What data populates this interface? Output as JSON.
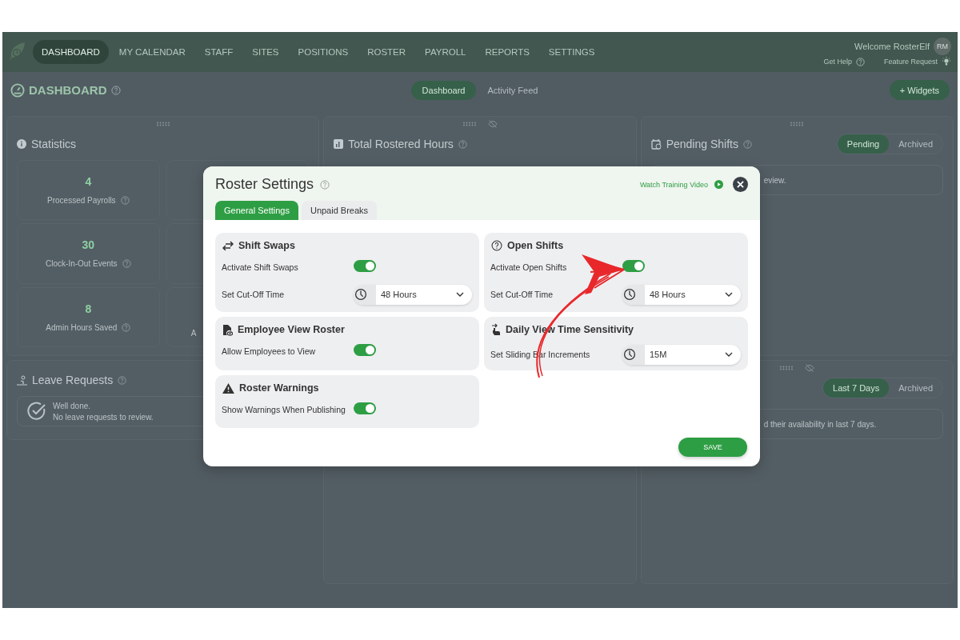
{
  "nav": {
    "items": [
      {
        "label": "DASHBOARD",
        "selected": true
      },
      {
        "label": "MY CALENDAR",
        "selected": false
      },
      {
        "label": "STAFF",
        "selected": false
      },
      {
        "label": "SITES",
        "selected": false
      },
      {
        "label": "POSITIONS",
        "selected": false
      },
      {
        "label": "ROSTER",
        "selected": false
      },
      {
        "label": "PAYROLL",
        "selected": false
      },
      {
        "label": "REPORTS",
        "selected": false
      },
      {
        "label": "SETTINGS",
        "selected": false
      }
    ],
    "welcome": "Welcome RosterElf",
    "avatar": "RM",
    "help": "Get Help",
    "feature": "Feature Request"
  },
  "header": {
    "title": "DASHBOARD",
    "views": [
      {
        "label": "Dashboard",
        "selected": true
      },
      {
        "label": "Activity Feed",
        "selected": false
      }
    ],
    "add_button": "+ Widgets"
  },
  "statistics": {
    "title": "Statistics",
    "stats": [
      {
        "value": "4",
        "label": "Processed Payrolls"
      },
      {
        "value": "30",
        "label": "Clock-In-Out Events"
      },
      {
        "value": "8",
        "label": "Admin Hours Saved"
      }
    ],
    "partial_label": "A"
  },
  "rostered_hours": {
    "title": "Total Rostered Hours"
  },
  "pending_shifts": {
    "title": "Pending Shifts",
    "filters": [
      {
        "label": "Pending",
        "selected": true
      },
      {
        "label": "Archived",
        "selected": false
      }
    ],
    "message": "eview."
  },
  "leave_requests": {
    "title": "Leave Requests",
    "message_title": "Well done.",
    "message": "No leave requests to review."
  },
  "availability": {
    "filters": [
      {
        "label": "Last 7 Days",
        "selected": true
      },
      {
        "label": "Archived",
        "selected": false
      }
    ],
    "message": "d their availability in last 7 days."
  },
  "modal": {
    "title": "Roster Settings",
    "video_link": "Watch Training Video",
    "tabs": [
      {
        "label": "General Settings",
        "selected": true
      },
      {
        "label": "Unpaid Breaks",
        "selected": false
      }
    ],
    "sections": [
      {
        "title": "Shift Swaps",
        "kind": "swap",
        "rows": [
          {
            "kind": "toggle",
            "label": "Activate Shift Swaps",
            "on": true
          },
          {
            "kind": "select",
            "label": "Set Cut-Off Time",
            "value": "48 Hours"
          }
        ]
      },
      {
        "title": "Open Shifts",
        "kind": "question",
        "rows": [
          {
            "kind": "toggle",
            "label": "Activate Open Shifts",
            "on": true
          },
          {
            "kind": "select",
            "label": "Set Cut-Off Time",
            "value": "48 Hours"
          }
        ]
      },
      {
        "title": "Employee View Roster",
        "kind": "document",
        "rows": [
          {
            "kind": "toggle",
            "label": "Allow Employees to View",
            "on": true
          }
        ]
      },
      {
        "title": "Daily View Time Sensitivity",
        "kind": "hand",
        "rows": [
          {
            "kind": "select",
            "label": "Set Sliding Bar Increments",
            "value": "15M"
          }
        ]
      },
      {
        "title": "Roster Warnings",
        "kind": "warning",
        "rows": [
          {
            "kind": "toggle",
            "label": "Show Warnings When Publishing",
            "on": true
          }
        ]
      }
    ],
    "save_button": "SAVE"
  }
}
